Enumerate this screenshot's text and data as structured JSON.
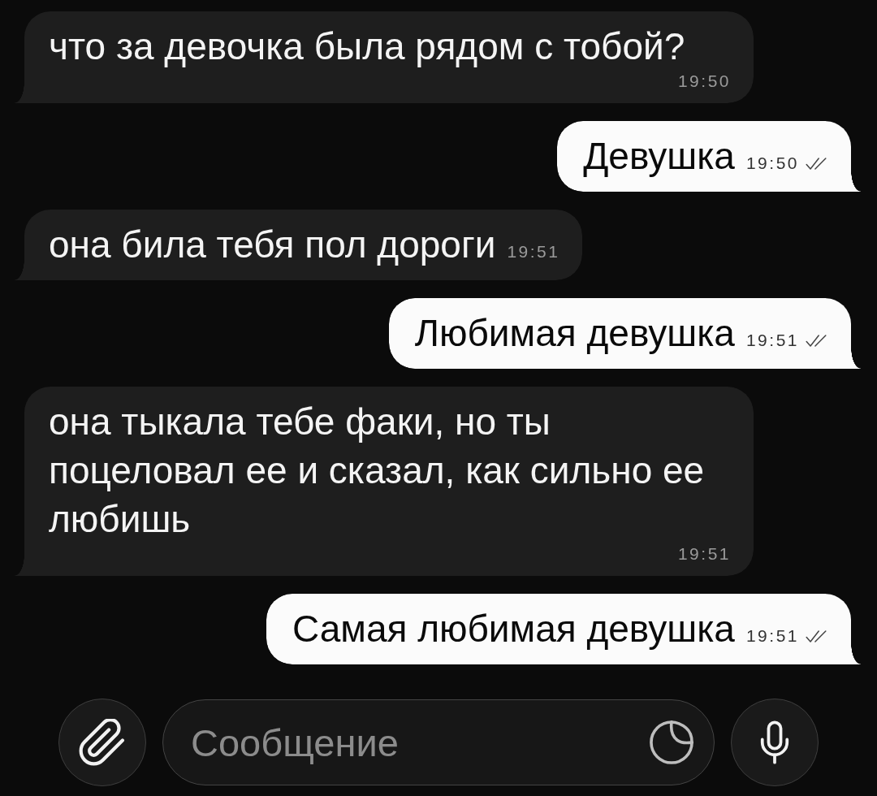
{
  "messages": [
    {
      "kind": "incoming",
      "text": "что за девочка была рядом с тобой?",
      "time": "19:50"
    },
    {
      "kind": "outgoing",
      "text": "Девушка",
      "time": "19:50",
      "read": true
    },
    {
      "kind": "incoming",
      "text": "она била тебя пол дороги",
      "time": "19:51"
    },
    {
      "kind": "outgoing",
      "text": "Любимая девушка",
      "time": "19:51",
      "read": true
    },
    {
      "kind": "incoming",
      "text": "она тыкала тебе факи, но ты поцеловал ее и сказал, как сильно ее любишь",
      "time": "19:51"
    },
    {
      "kind": "outgoing",
      "text": "Самая любимая девушка",
      "time": "19:51",
      "read": true
    }
  ],
  "composer": {
    "placeholder": "Сообщение"
  }
}
